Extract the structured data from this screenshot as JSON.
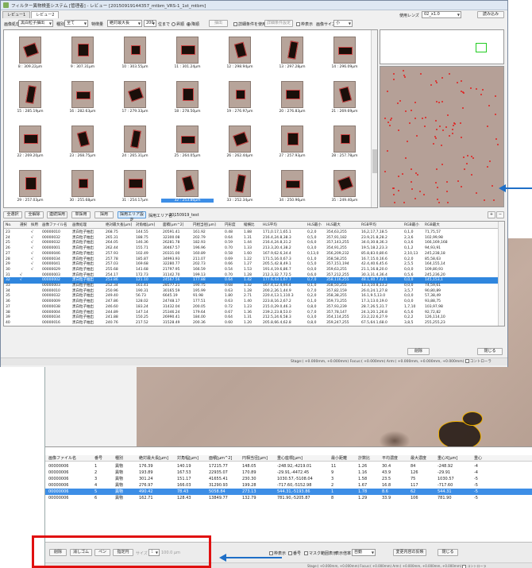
{
  "window": {
    "title": "フィルター異物検査システム [管理者] - レビュー [20150919144357_mtbm_VRS-1_1st_mtbm]",
    "tabs": [
      "レビュー1",
      "レビュー2"
    ],
    "controls": {
      "min": "—",
      "max": "□",
      "close": "✕"
    }
  },
  "filter_bar": {
    "image_processing_label": "画像処理",
    "image_processing_value": "黒白粒子抽出",
    "type_label": "種別",
    "type_value": "全て",
    "feature_label": "特徴量",
    "feature_value": "絶対最大長",
    "count_value": "200",
    "count_suffix": "位まで",
    "radio_asc": "昇順",
    "radio_desc": "降順",
    "extract_button": "抽出",
    "detail_condition_label": "詳細条件を使用",
    "detail_setting_button": "詳細条件設定",
    "lens_label": "使用レンズ",
    "lens_value": "02_x1.0",
    "read_button": "読み込み",
    "frame_label": "枠表示",
    "image_size_label": "画像サイズ",
    "image_size_value": "小"
  },
  "grid": {
    "captions": [
      "8 : 309.22μm",
      "9 : 307.31μm",
      "10 : 303.55μm",
      "11 : 301.24μm",
      "12 : 298.94μm",
      "13 : 297.28μm",
      "14 : 296.09μm",
      "15 : 285.19μm",
      "16 : 282.63μm",
      "17 : 279.33μm",
      "18 : 278.50μm",
      "19 : 276.97μm",
      "20 : 276.83μm",
      "21 : 269.69μm",
      "22 : 269.20μm",
      "23 : 268.75μm",
      "24 : 265.31μm",
      "25 : 264.05μm",
      "26 : 262.44μm",
      "27 : 257.93μm",
      "28 : 257.78μm",
      "29 : 257.03μm",
      "30 : 255.68μm",
      "31 : 254.17μm",
      "32 : 253.86μm",
      "33 : 252.34μm",
      "34 : 250.96μm",
      "35 : 249.40μm"
    ],
    "selected_index": 24
  },
  "toolbar": {
    "select_all": "全選択",
    "deselect_all": "全解除",
    "batch_adopt": "連続採用",
    "single_adopt": "単採用",
    "adopt": "採用",
    "adopt_area_setting": "採用エリア設定",
    "adopt_area_label": "採用エリア名 :",
    "adopt_area_value": "20150919_test",
    "plus": "+",
    "minus": "−"
  },
  "table": {
    "headers": [
      "No.",
      "選択",
      "採用",
      "画像ファイル名",
      "画像処理",
      "絶対最大長[μm]",
      "対角幅[μm]",
      "面積[μm^2]",
      "円相当径[μm]",
      "円形度",
      "縦横比",
      "HLS平均",
      "HLS最小",
      "HLS最大",
      "RGB平均",
      "RGB最小",
      "RGB最大"
    ],
    "rows": [
      [
        "23",
        "",
        "√",
        "00000010",
        "黒白粒子抽出",
        "268.75",
        "144.55",
        "20591.41",
        "161.92",
        "0.48",
        "1.88",
        "171,0.17,1,65.1",
        "0,2,0",
        "354,63,255",
        "16,2,17,7,18.5",
        "0,1,0",
        "71,75,57"
      ],
      [
        "24",
        "",
        "√",
        "00000032",
        "黒白粒子抽出",
        "265.31",
        "188.75",
        "32300.08",
        "202.79",
        "0.64",
        "1.31",
        "216.4,24.8,38.3",
        "0,5,0",
        "357,91,182",
        "23.9,21.8,28.2",
        "2,3,6",
        "102,99,98"
      ],
      [
        "25",
        "",
        "√",
        "00000032",
        "黒白粒子抽出",
        "264.05",
        "146.36",
        "26281.78",
        "182.93",
        "0.59",
        "1.44",
        "216.4,24.8,31.2",
        "0,6,0",
        "357,143,255",
        "34.0,30.8,36.3",
        "0,3,6",
        "166,169,168"
      ],
      [
        "26",
        "",
        "√",
        "00000001",
        "黒白粒子抽出",
        "262.44",
        "155.71",
        "30467.57",
        "196.96",
        "0.70",
        "1.33",
        "213.3,20.4,38.2",
        "0,3,0",
        "354,91,255",
        "19.5,18.2,23.3",
        "0,1,2",
        "94,93,91"
      ],
      [
        "27",
        "",
        "√",
        "00000046",
        "黒白粒子抽出",
        "257.93",
        "102.49",
        "20331.00",
        "160.89",
        "0.58",
        "1.60",
        "167.9,62.6,34.4",
        "0,13,0",
        "356,209,232",
        "85.8,83.0,80.6",
        "2,10,13",
        "245,238,18"
      ],
      [
        "28",
        "",
        "√",
        "00000034",
        "黒白粒子抽出",
        "257.78",
        "185.87",
        "34993.93",
        "211.07",
        "0.69",
        "1.22",
        "171.5,16.0,67.3",
        "0,1,0",
        "358,58,255",
        "16.7,15.0,16.6",
        "0,2,0",
        "85,58,63"
      ],
      [
        "29",
        "",
        "√",
        "00000041",
        "黒白粒子抽出",
        "257.03",
        "169.68",
        "32280.77",
        "202.73",
        "0.66",
        "1.27",
        "205.5,42.8,49.1",
        "0,5,0",
        "357,151,194",
        "42.4,40.6,45.6",
        "2,5,5",
        "164,155,14"
      ],
      [
        "30",
        "",
        "√",
        "00000029",
        "黒白粒子抽出",
        "255.68",
        "141.68",
        "21797.95",
        "166.59",
        "0.54",
        "1.53",
        "191.4,19.6,86.7",
        "0,0,0",
        "359,63,255",
        "21.1,16.8,20.0",
        "0,0,0",
        "109,80,93"
      ],
      [
        "31",
        "√",
        "",
        "00000003",
        "黒白粒子抽出",
        "254.17",
        "172.73",
        "31142.70",
        "199.13",
        "0.70",
        "1.28",
        "212.3,32.7,72.5",
        "0,6,0",
        "357,212,255",
        "30.3,31.4,36.4",
        "0,5,6",
        "245,236,20"
      ],
      [
        "32",
        "√",
        "",
        "00000002",
        "黒白粒子抽出",
        "253.86",
        "121.10",
        "24567.56",
        "177.88",
        "0.64",
        "1.42",
        "177.6,43.1,67.7",
        "0,7,0",
        "358,116,255",
        "48.1,40.7,42.1",
        "0,0,0",
        "145,153,1"
      ],
      [
        "33",
        "",
        "",
        "00000003",
        "黒白粒子抽出",
        "252.34",
        "161.41",
        "28577.21",
        "190.75",
        "0.68",
        "1.32",
        "167.4,12.4,94.4",
        "0,1,0",
        "358,50,255",
        "13.3,10.8,13.2",
        "0,0,0",
        "74,59,61"
      ],
      [
        "34",
        "",
        "",
        "00000010",
        "黒白粒子抽出",
        "250.96",
        "190.31",
        "30165.59",
        "195.99",
        "0.63",
        "1.28",
        "200.2,26.1,44.9",
        "0,7,0",
        "357,82,159",
        "26.0,24.1,27.8",
        "3,5,7",
        "90,80,89"
      ],
      [
        "35",
        "",
        "",
        "00000032",
        "黒白粒子抽出",
        "249.40",
        "56.73",
        "6645.19",
        "91.98",
        "1.80",
        "2.71",
        "220.4,13.1,110.3",
        "0,2,0",
        "358,38,255",
        "16.1,9.5,13.0",
        "0,0,0",
        "57,38,49"
      ],
      [
        "36",
        "",
        "",
        "00000009",
        "黒白粒子抽出",
        "247.86",
        "128.02",
        "24748.17",
        "177.51",
        "0.63",
        "1.40",
        "223.8,16.2,67.2",
        "0,1,0",
        "359,73,255",
        "17.3,13.0,19.0",
        "0,0,0",
        "93,88,75"
      ],
      [
        "37",
        "",
        "",
        "00000038",
        "黒白粒子抽出",
        "246.60",
        "183.24",
        "31432.04",
        "200.05",
        "0.72",
        "1.23",
        "215.0,29.0,46.3",
        "0,8,0",
        "357,93,239",
        "28.7,26.5,31.7",
        "1,7,10",
        "103,97,98"
      ],
      [
        "38",
        "",
        "",
        "00000004",
        "黒白粒子抽出",
        "244.89",
        "147.14",
        "25346.24",
        "179.64",
        "0.67",
        "1.36",
        "239.2,23.8,53.0",
        "0,7,0",
        "357,78,147",
        "24.3,20.1,26.8",
        "6,5,6",
        "92,72,82"
      ],
      [
        "39",
        "",
        "",
        "00000034",
        "黒白粒子抽出",
        "241.88",
        "150.25",
        "26990.41",
        "184.00",
        "0.64",
        "1.31",
        "212.5,24.6,58.3",
        "0,3,0",
        "354,114,255",
        "23.2,22.6,27.9",
        "0,2,2",
        "126,114,10"
      ],
      [
        "40",
        "",
        "",
        "00000016",
        "黒白粒子抽出",
        "240.76",
        "217.52",
        "31528.49",
        "200.36",
        "0.60",
        "1.20",
        "205.8,66.4,62.8",
        "0,8,0",
        "359,247,255",
        "67.5,64.1,68.0",
        "3,8,5",
        "255,255,23"
      ]
    ],
    "selected_row": 9
  },
  "front_footer": {
    "delete_button": "削除",
    "close_button": "閉じる",
    "status": "Stage:( +0.000mm, +0.000mm)  Focus:( +0.000mm)  Arm:( +0.000mm, +0.000mm, +0.000mm)",
    "controller_label": "コントローラ"
  },
  "back_table": {
    "headers": [
      "画像ファイル名",
      "番号",
      "種別",
      "絶対最大長[μm]",
      "対角幅[μm]",
      "面積[μm^2]",
      "円相当径[μm]",
      "重心座標[μm]",
      "最小距離",
      "計数比",
      "平均濃度",
      "最大濃度",
      "重心X[μm]",
      "重心"
    ],
    "rows": [
      [
        "00000006",
        "1",
        "異物",
        "176.39",
        "140.19",
        "17215.77",
        "148.05",
        "-248.92,-4219.01",
        "11",
        "1.26",
        "30.4",
        "84",
        "-248.92",
        "-4"
      ],
      [
        "00000006",
        "2",
        "異物",
        "193.89",
        "167.53",
        "22935.07",
        "170.89",
        "-29.91,-4472.45",
        "9",
        "1.16",
        "43.9",
        "126",
        "-29.91",
        "-4"
      ],
      [
        "00000006",
        "3",
        "異物",
        "301.24",
        "151.17",
        "41655.41",
        "230.30",
        "1030.57,-5108.04",
        "3",
        "1.58",
        "23.5",
        "75",
        "1030.57",
        "-5"
      ],
      [
        "00000006",
        "4",
        "異物",
        "276.97",
        "166.03",
        "31290.93",
        "199.28",
        "-717.60,-5152.98",
        "2",
        "1.67",
        "16.8",
        "117",
        "-717.60",
        "-5"
      ],
      [
        "00000006",
        "5",
        "異物",
        "490.42",
        "78.43",
        "5058.84",
        "273.13",
        "544.31,-5193.86",
        "1",
        "1.78",
        "8.6",
        "62",
        "544.31",
        "-5"
      ],
      [
        "00000006",
        "6",
        "異物",
        "162.71",
        "128.43",
        "13849.77",
        "132.79",
        "781.90,-5205.87",
        "8",
        "1.29",
        "33.9",
        "106",
        "781.90",
        "-5"
      ]
    ],
    "selected_row": 4
  },
  "back_footer": {
    "delete_button": "削除",
    "eraser_button": "消しゴム",
    "pen_button": "ペン",
    "designate_button": "指定円",
    "size_label": "サイズ",
    "size_value": "1",
    "size_max": "100.0",
    "size_unit": "μm",
    "frame_checkbox": "枠表示",
    "number_checkbox": "番号",
    "mask_checkbox": "マスク範囲表示",
    "display_label": "表示倍率",
    "display_value": "自動",
    "feature_button": "変更内容の反映",
    "close_button": "閉じる",
    "status": "Stage:( +0.000mm, +0.000mm)  Focus:( +0.000mm)  Arm:( +0.000mm, +0.000mm, +0.000mm)",
    "controller_label": "コントローラ"
  },
  "colors": {
    "selection": "#2f86de",
    "highlight_box": "#e01010",
    "annotation_arrow": "#1f6fc7",
    "overview_dots": "#e02020"
  }
}
